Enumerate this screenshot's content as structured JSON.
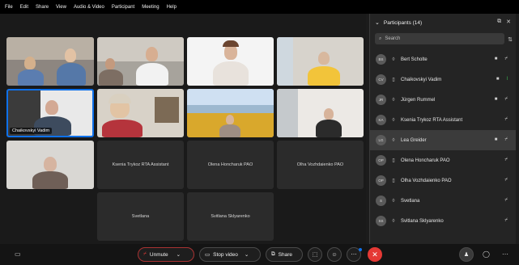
{
  "menu": [
    "File",
    "Edit",
    "Share",
    "View",
    "Audio & Video",
    "Participant",
    "Meeting",
    "Help"
  ],
  "tiles": {
    "active_name": "Chaikovskyi Vadim",
    "off": [
      "Ksenia Trykoz RTA Assistant",
      "Olena Honcharuk PAO",
      "Olha Vozhdaienko PAO",
      "Svetlana",
      "Svitlana Sklyarenko"
    ]
  },
  "panel": {
    "title": "Participants (14)",
    "search_placeholder": "Search",
    "participants": [
      {
        "initials": "BS",
        "name": "Bert Scholte",
        "selected": false
      },
      {
        "initials": "CV",
        "name": "Chaikovskyi Vadim",
        "selected": false
      },
      {
        "initials": "JR",
        "name": "Jürgen Rummel",
        "selected": false
      },
      {
        "initials": "KA",
        "name": "Ksenia Trykoz RTA Assistant",
        "selected": false
      },
      {
        "initials": "LG",
        "name": "Lea Greider",
        "selected": true
      },
      {
        "initials": "OP",
        "name": "Olena Honcharuk PAO",
        "selected": false
      },
      {
        "initials": "OP",
        "name": "Olha Vozhdaienko PAO",
        "selected": false
      },
      {
        "initials": "S",
        "name": "Svetlana",
        "selected": false
      },
      {
        "initials": "SS",
        "name": "Svitlana Sklyarenko",
        "selected": false
      }
    ]
  },
  "toolbar": {
    "unmute_label": "Unmute",
    "stop_video_label": "Stop video",
    "share_label": "Share"
  },
  "colors": {
    "accent": "#0e71eb",
    "end_call": "#e53935",
    "panel_bg": "#242424"
  }
}
